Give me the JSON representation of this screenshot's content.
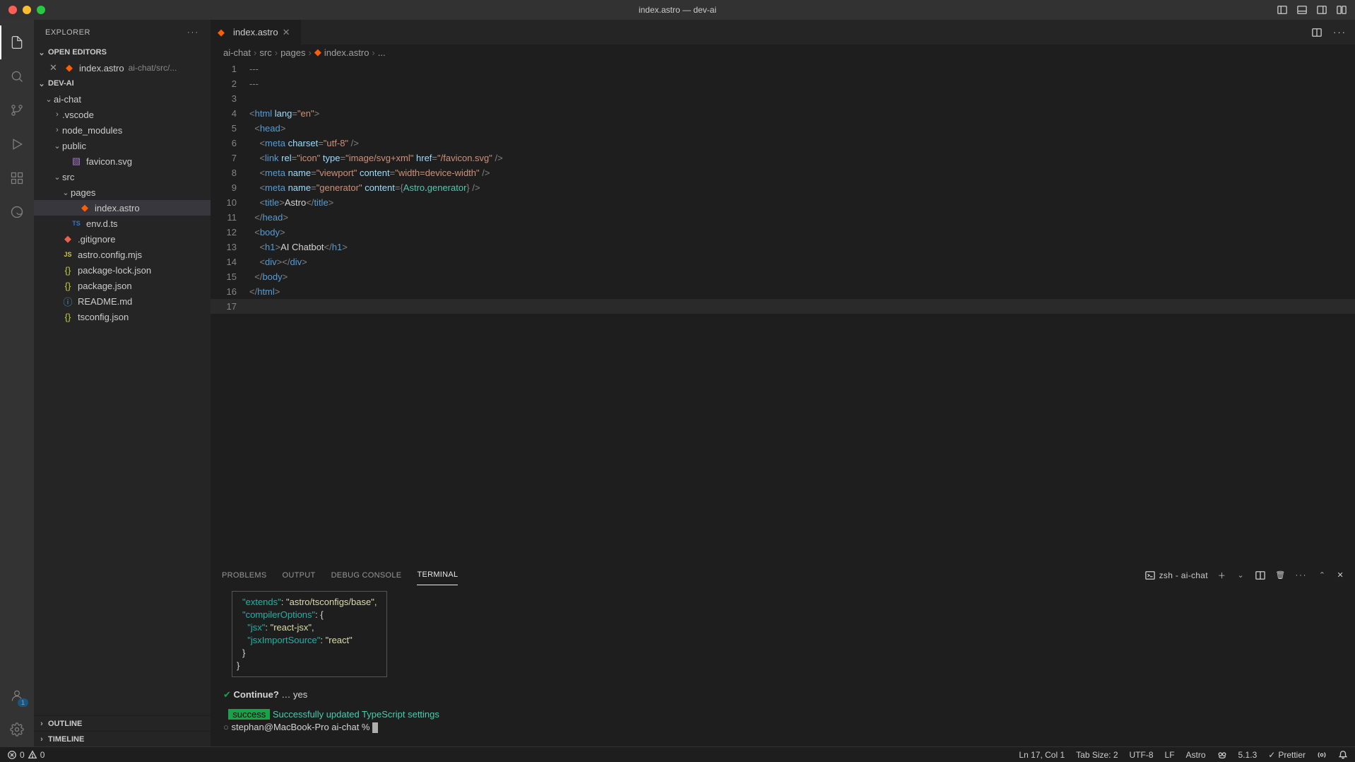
{
  "window": {
    "title": "index.astro — dev-ai"
  },
  "explorer": {
    "title": "EXPLORER",
    "openEditors": {
      "label": "OPEN EDITORS",
      "items": [
        {
          "name": "index.astro",
          "desc": "ai-chat/src/..."
        }
      ]
    },
    "workspace": {
      "label": "DEV-AI",
      "tree": [
        {
          "type": "folder",
          "name": "ai-chat",
          "depth": 0,
          "open": true
        },
        {
          "type": "folder",
          "name": ".vscode",
          "depth": 1,
          "open": false
        },
        {
          "type": "folder",
          "name": "node_modules",
          "depth": 1,
          "open": false
        },
        {
          "type": "folder",
          "name": "public",
          "depth": 1,
          "open": true
        },
        {
          "type": "file",
          "name": "favicon.svg",
          "depth": 2,
          "icon": "svg"
        },
        {
          "type": "folder",
          "name": "src",
          "depth": 1,
          "open": true
        },
        {
          "type": "folder",
          "name": "pages",
          "depth": 2,
          "open": true
        },
        {
          "type": "file",
          "name": "index.astro",
          "depth": 3,
          "icon": "astro",
          "selected": true
        },
        {
          "type": "file",
          "name": "env.d.ts",
          "depth": 2,
          "icon": "ts"
        },
        {
          "type": "file",
          "name": ".gitignore",
          "depth": 1,
          "icon": "git"
        },
        {
          "type": "file",
          "name": "astro.config.mjs",
          "depth": 1,
          "icon": "js"
        },
        {
          "type": "file",
          "name": "package-lock.json",
          "depth": 1,
          "icon": "json"
        },
        {
          "type": "file",
          "name": "package.json",
          "depth": 1,
          "icon": "json"
        },
        {
          "type": "file",
          "name": "README.md",
          "depth": 1,
          "icon": "md"
        },
        {
          "type": "file",
          "name": "tsconfig.json",
          "depth": 1,
          "icon": "json"
        }
      ]
    },
    "outline": "OUTLINE",
    "timeline": "TIMELINE"
  },
  "tabs": [
    {
      "name": "index.astro",
      "icon": "astro",
      "active": true
    }
  ],
  "breadcrumbs": [
    "ai-chat",
    "src",
    "pages",
    "index.astro",
    "..."
  ],
  "editor": {
    "lines": [
      {
        "n": 1,
        "segs": [
          [
            "gray",
            "---"
          ]
        ]
      },
      {
        "n": 2,
        "segs": [
          [
            "gray",
            "---"
          ]
        ]
      },
      {
        "n": 3,
        "segs": []
      },
      {
        "n": 4,
        "segs": [
          [
            "punct",
            "<"
          ],
          [
            "tag",
            "html "
          ],
          [
            "attr",
            "lang"
          ],
          [
            "punct",
            "="
          ],
          [
            "str",
            "\"en\""
          ],
          [
            "punct",
            ">"
          ]
        ]
      },
      {
        "n": 5,
        "segs": [
          [
            "text",
            "  "
          ],
          [
            "punct",
            "<"
          ],
          [
            "tag",
            "head"
          ],
          [
            "punct",
            ">"
          ]
        ]
      },
      {
        "n": 6,
        "segs": [
          [
            "text",
            "    "
          ],
          [
            "punct",
            "<"
          ],
          [
            "tag",
            "meta "
          ],
          [
            "attr",
            "charset"
          ],
          [
            "punct",
            "="
          ],
          [
            "str",
            "\"utf-8\""
          ],
          [
            "punct",
            " />"
          ]
        ]
      },
      {
        "n": 7,
        "segs": [
          [
            "text",
            "    "
          ],
          [
            "punct",
            "<"
          ],
          [
            "tag",
            "link "
          ],
          [
            "attr",
            "rel"
          ],
          [
            "punct",
            "="
          ],
          [
            "str",
            "\"icon\""
          ],
          [
            "tag",
            " "
          ],
          [
            "attr",
            "type"
          ],
          [
            "punct",
            "="
          ],
          [
            "str",
            "\"image/svg+xml\""
          ],
          [
            "tag",
            " "
          ],
          [
            "attr",
            "href"
          ],
          [
            "punct",
            "="
          ],
          [
            "str",
            "\"/favicon.svg\""
          ],
          [
            "punct",
            " />"
          ]
        ]
      },
      {
        "n": 8,
        "segs": [
          [
            "text",
            "    "
          ],
          [
            "punct",
            "<"
          ],
          [
            "tag",
            "meta "
          ],
          [
            "attr",
            "name"
          ],
          [
            "punct",
            "="
          ],
          [
            "str",
            "\"viewport\""
          ],
          [
            "tag",
            " "
          ],
          [
            "attr",
            "content"
          ],
          [
            "punct",
            "="
          ],
          [
            "str",
            "\"width=device-width\""
          ],
          [
            "punct",
            " />"
          ]
        ]
      },
      {
        "n": 9,
        "segs": [
          [
            "text",
            "    "
          ],
          [
            "punct",
            "<"
          ],
          [
            "tag",
            "meta "
          ],
          [
            "attr",
            "name"
          ],
          [
            "punct",
            "="
          ],
          [
            "str",
            "\"generator\""
          ],
          [
            "tag",
            " "
          ],
          [
            "attr",
            "content"
          ],
          [
            "punct",
            "={"
          ],
          [
            "expr",
            "Astro"
          ],
          [
            "text",
            "."
          ],
          [
            "expr",
            "generator"
          ],
          [
            "punct",
            "} />"
          ]
        ]
      },
      {
        "n": 10,
        "segs": [
          [
            "text",
            "    "
          ],
          [
            "punct",
            "<"
          ],
          [
            "tag",
            "title"
          ],
          [
            "punct",
            ">"
          ],
          [
            "text",
            "Astro"
          ],
          [
            "punct",
            "</"
          ],
          [
            "tag",
            "title"
          ],
          [
            "punct",
            ">"
          ]
        ]
      },
      {
        "n": 11,
        "segs": [
          [
            "text",
            "  "
          ],
          [
            "punct",
            "</"
          ],
          [
            "tag",
            "head"
          ],
          [
            "punct",
            ">"
          ]
        ]
      },
      {
        "n": 12,
        "segs": [
          [
            "text",
            "  "
          ],
          [
            "punct",
            "<"
          ],
          [
            "tag",
            "body"
          ],
          [
            "punct",
            ">"
          ]
        ]
      },
      {
        "n": 13,
        "segs": [
          [
            "text",
            "    "
          ],
          [
            "punct",
            "<"
          ],
          [
            "tag",
            "h1"
          ],
          [
            "punct",
            ">"
          ],
          [
            "text",
            "AI Chatbot"
          ],
          [
            "punct",
            "</"
          ],
          [
            "tag",
            "h1"
          ],
          [
            "punct",
            ">"
          ]
        ]
      },
      {
        "n": 14,
        "segs": [
          [
            "text",
            "    "
          ],
          [
            "punct",
            "<"
          ],
          [
            "tag",
            "div"
          ],
          [
            "punct",
            "></"
          ],
          [
            "tag",
            "div"
          ],
          [
            "punct",
            ">"
          ]
        ]
      },
      {
        "n": 15,
        "segs": [
          [
            "text",
            "  "
          ],
          [
            "punct",
            "</"
          ],
          [
            "tag",
            "body"
          ],
          [
            "punct",
            ">"
          ]
        ]
      },
      {
        "n": 16,
        "segs": [
          [
            "punct",
            "</"
          ],
          [
            "tag",
            "html"
          ],
          [
            "punct",
            ">"
          ]
        ]
      },
      {
        "n": 17,
        "segs": [],
        "current": true
      }
    ]
  },
  "panel": {
    "tabs": [
      "PROBLEMS",
      "OUTPUT",
      "DEBUG CONSOLE",
      "TERMINAL"
    ],
    "activeTab": "TERMINAL",
    "terminalLabel": "zsh - ai-chat",
    "box": {
      "l1": {
        "key": "\"extends\"",
        "val": "\"astro/tsconfigs/base\"",
        "trail": ","
      },
      "l2": {
        "key": "\"compilerOptions\"",
        "val": ": {"
      },
      "l3": {
        "key": "\"jsx\"",
        "val": "\"react-jsx\"",
        "trail": ","
      },
      "l4": {
        "key": "\"jsxImportSource\"",
        "val": "\"react\""
      },
      "l5": "}",
      "l6": "}"
    },
    "continue": {
      "prompt": "Continue?",
      "dots": "…",
      "answer": "yes"
    },
    "success": {
      "badge": "success",
      "msg": "Successfully updated TypeScript settings"
    },
    "promptLine": {
      "circle": "○",
      "text": "stephan@MacBook-Pro ai-chat % "
    }
  },
  "statusbar": {
    "errors": "0",
    "warnings": "0",
    "lncol": "Ln 17, Col 1",
    "tabsize": "Tab Size: 2",
    "encoding": "UTF-8",
    "eol": "LF",
    "lang": "Astro",
    "version": "5.1.3",
    "prettier": "Prettier"
  },
  "activityBadge": "1"
}
